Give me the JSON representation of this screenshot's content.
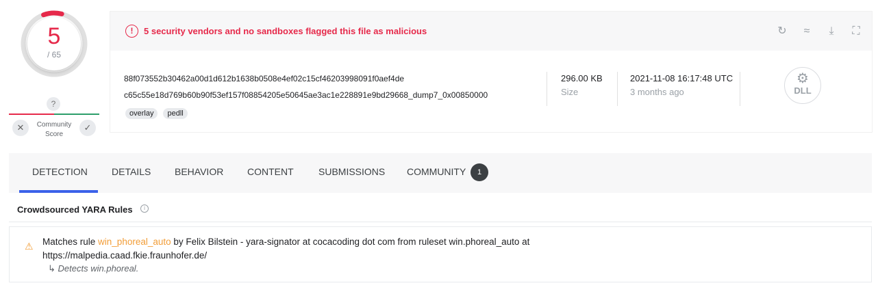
{
  "score": {
    "detections": "5",
    "total": "/ 65",
    "score_fraction": 0.077
  },
  "community": {
    "question": "?",
    "label": "Community Score",
    "x_icon": "close-icon",
    "check_icon": "check-icon"
  },
  "alert": {
    "text": "5 security vendors and no sandboxes flagged this file as malicious",
    "icon": "!"
  },
  "toolbar": {
    "reanalyze": "↻",
    "similar": "≈",
    "download": "⤓",
    "graph": "⛶"
  },
  "file": {
    "hash": "88f073552b30462a00d1d612b1638b0508e4ef02c15cf46203998091f0aef4de",
    "name": "c65c55e18d769b60b90f53ef157f08854205e50645ae3ac1e228891e9bd29668_dump7_0x00850000",
    "tags": [
      "overlay",
      "pedll"
    ],
    "size_value": "296.00 KB",
    "size_label": "Size",
    "date_value": "2021-11-08 16:17:48 UTC",
    "date_label": "3 months ago",
    "type": "DLL"
  },
  "tabs": [
    "DETECTION",
    "DETAILS",
    "BEHAVIOR",
    "CONTENT",
    "SUBMISSIONS",
    "COMMUNITY"
  ],
  "community_badge": "1",
  "section": {
    "title": "Crowdsourced YARA Rules",
    "info": "i"
  },
  "rule": {
    "prefix": "Matches rule ",
    "name": "win_phoreal_auto",
    "suffix": " by Felix Bilstein - yara-signator at cocacoding dot com from ruleset win.phoreal_auto at",
    "url": "https://malpedia.caad.fkie.fraunhofer.de/",
    "arrow": "↳",
    "description": "Detects win.phoreal."
  },
  "colors": {
    "danger": "#e6294a",
    "accent": "#3b61e9",
    "warning": "#f29d38"
  }
}
